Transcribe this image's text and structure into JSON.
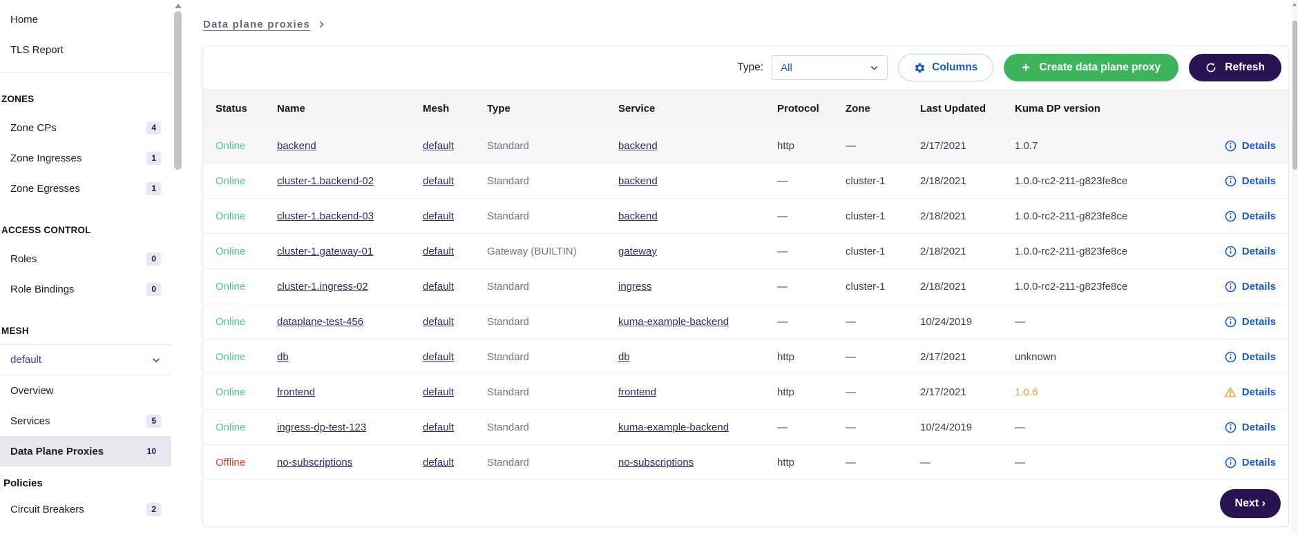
{
  "colors": {
    "accent_blue": "#1659c7",
    "link_purple": "#322a60",
    "online_green": "#4ecb87",
    "offline_red": "#e53a21",
    "warning_orange": "#e0a030",
    "create_button_green": "#3eb45c",
    "dark_purple_button": "#291453",
    "selected_item_bg": "#e8e8ee",
    "badge_bg": "#e9e7f4",
    "table_header_bg": "#f4f4f6"
  },
  "sidebar": {
    "items": [
      {
        "type": "link",
        "label": "Home"
      },
      {
        "type": "link",
        "label": "TLS Report"
      },
      {
        "type": "divider"
      },
      {
        "type": "section",
        "label": "ZONES"
      },
      {
        "type": "link",
        "label": "Zone CPs",
        "badge": "4"
      },
      {
        "type": "link",
        "label": "Zone Ingresses",
        "badge": "1"
      },
      {
        "type": "link",
        "label": "Zone Egresses",
        "badge": "1"
      },
      {
        "type": "section",
        "label": "ACCESS CONTROL"
      },
      {
        "type": "link",
        "label": "Roles",
        "badge": "0"
      },
      {
        "type": "link",
        "label": "Role Bindings",
        "badge": "0"
      },
      {
        "type": "section",
        "label": "MESH"
      },
      {
        "type": "mesh-selector",
        "label": "default"
      },
      {
        "type": "link",
        "label": "Overview"
      },
      {
        "type": "link",
        "label": "Services",
        "badge": "5"
      },
      {
        "type": "link",
        "label": "Data Plane Proxies",
        "badge": "10",
        "selected": true
      },
      {
        "type": "subheader",
        "label": "Policies"
      },
      {
        "type": "link",
        "label": "Circuit Breakers",
        "badge": "2"
      }
    ]
  },
  "breadcrumb": {
    "label": "Data plane proxies"
  },
  "toolbar": {
    "type_label": "Type:",
    "type_value": "All",
    "columns_label": "Columns",
    "create_label": "Create data plane proxy",
    "refresh_label": "Refresh"
  },
  "table": {
    "columns": [
      "Status",
      "Name",
      "Mesh",
      "Type",
      "Service",
      "Protocol",
      "Zone",
      "Last Updated",
      "Kuma DP version"
    ],
    "details_label": "Details",
    "rows": [
      {
        "status": "Online",
        "name": "backend",
        "mesh": "default",
        "type": "Standard",
        "service": "backend",
        "protocol": "http",
        "zone": "—",
        "last_updated": "2/17/2021",
        "version": "1.0.7",
        "details_icon": "info",
        "highlighted": true
      },
      {
        "status": "Online",
        "name": "cluster-1.backend-02",
        "mesh": "default",
        "type": "Standard",
        "service": "backend",
        "protocol": "—",
        "zone": "cluster-1",
        "last_updated": "2/18/2021",
        "version": "1.0.0-rc2-211-g823fe8ce",
        "details_icon": "info"
      },
      {
        "status": "Online",
        "name": "cluster-1.backend-03",
        "mesh": "default",
        "type": "Standard",
        "service": "backend",
        "protocol": "—",
        "zone": "cluster-1",
        "last_updated": "2/18/2021",
        "version": "1.0.0-rc2-211-g823fe8ce",
        "details_icon": "info"
      },
      {
        "status": "Online",
        "name": "cluster-1.gateway-01",
        "mesh": "default",
        "type": "Gateway (BUILTIN)",
        "service": "gateway",
        "protocol": "—",
        "zone": "cluster-1",
        "last_updated": "2/18/2021",
        "version": "1.0.0-rc2-211-g823fe8ce",
        "details_icon": "info"
      },
      {
        "status": "Online",
        "name": "cluster-1.ingress-02",
        "mesh": "default",
        "type": "Standard",
        "service": "ingress",
        "protocol": "—",
        "zone": "cluster-1",
        "last_updated": "2/18/2021",
        "version": "1.0.0-rc2-211-g823fe8ce",
        "details_icon": "info"
      },
      {
        "status": "Online",
        "name": "dataplane-test-456",
        "mesh": "default",
        "type": "Standard",
        "service": "kuma-example-backend",
        "protocol": "—",
        "zone": "—",
        "last_updated": "10/24/2019",
        "version": "—",
        "details_icon": "info"
      },
      {
        "status": "Online",
        "name": "db",
        "mesh": "default",
        "type": "Standard",
        "service": "db",
        "protocol": "http",
        "zone": "—",
        "last_updated": "2/17/2021",
        "version": "unknown",
        "details_icon": "info"
      },
      {
        "status": "Online",
        "name": "frontend",
        "mesh": "default",
        "type": "Standard",
        "service": "frontend",
        "protocol": "http",
        "zone": "—",
        "last_updated": "2/17/2021",
        "version": "1.0.6",
        "version_warning": true,
        "details_icon": "warning"
      },
      {
        "status": "Online",
        "name": "ingress-dp-test-123",
        "mesh": "default",
        "type": "Standard",
        "service": "kuma-example-backend",
        "protocol": "—",
        "zone": "—",
        "last_updated": "10/24/2019",
        "version": "—",
        "details_icon": "info"
      },
      {
        "status": "Offline",
        "name": "no-subscriptions",
        "mesh": "default",
        "type": "Standard",
        "service": "no-subscriptions",
        "protocol": "http",
        "zone": "—",
        "last_updated": "—",
        "version": "—",
        "details_icon": "info"
      }
    ]
  },
  "pagination": {
    "next_label": "Next ›"
  }
}
